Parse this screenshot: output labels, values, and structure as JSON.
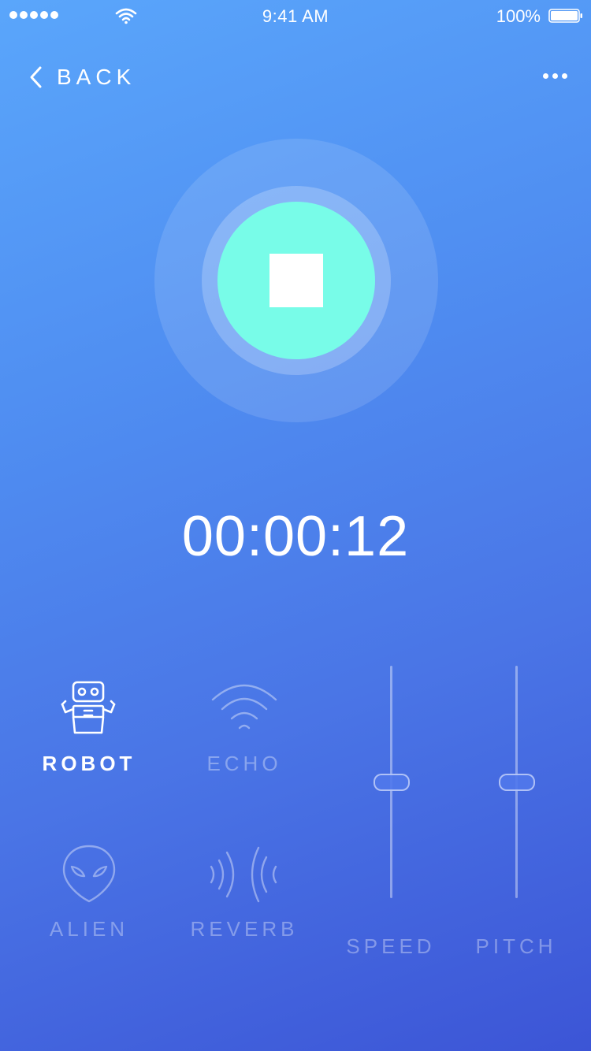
{
  "status_bar": {
    "time": "9:41 AM",
    "battery_percent": "100%",
    "signal_icon": "signal-dots-icon",
    "wifi_icon": "wifi-icon",
    "battery_icon": "battery-full-icon"
  },
  "nav": {
    "back_label": "BACK",
    "back_icon": "chevron-left-icon",
    "more_icon": "more-horizontal-icon"
  },
  "recorder": {
    "state": "recording",
    "stop_icon": "stop-icon",
    "accent_color": "#78fce8",
    "timer": "00:00:12"
  },
  "effects": [
    {
      "label": "ROBOT",
      "icon": "robot-icon",
      "active": true
    },
    {
      "label": "ECHO",
      "icon": "echo-icon",
      "active": false
    },
    {
      "label": "ALIEN",
      "icon": "alien-icon",
      "active": false
    },
    {
      "label": "REVERB",
      "icon": "reverb-icon",
      "active": false
    }
  ],
  "sliders": [
    {
      "label": "SPEED",
      "level": 0.5
    },
    {
      "label": "PITCH",
      "level": 0.5
    }
  ]
}
